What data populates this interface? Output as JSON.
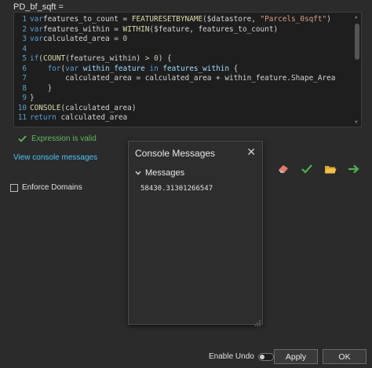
{
  "field": {
    "label": "PD_bf_sqft ="
  },
  "editor": {
    "lines": [
      {
        "num": "1",
        "tokens": [
          [
            "kw",
            "var"
          ],
          [
            "",
            "features_to_count = "
          ],
          [
            "fn",
            "FEATURESETBYNAME"
          ],
          [
            "",
            "($datastore, "
          ],
          [
            "str",
            "\"Parcels_0sqft\""
          ],
          [
            "",
            ")"
          ]
        ]
      },
      {
        "num": "2",
        "tokens": [
          [
            "kw",
            "var"
          ],
          [
            "",
            "features_within = "
          ],
          [
            "fn",
            "WITHIN"
          ],
          [
            "",
            "($feature, features_to_count)"
          ]
        ]
      },
      {
        "num": "3",
        "tokens": [
          [
            "kw",
            "var"
          ],
          [
            "",
            "calculated_area = "
          ],
          [
            "num",
            "0"
          ]
        ]
      },
      {
        "num": "4",
        "tokens": []
      },
      {
        "num": "5",
        "tokens": [
          [
            "kw",
            "if"
          ],
          [
            "",
            "("
          ],
          [
            "fn",
            "COUNT"
          ],
          [
            "",
            "(features_within) > "
          ],
          [
            "num",
            "0"
          ],
          [
            "",
            ") {"
          ]
        ]
      },
      {
        "num": "6",
        "tokens": [
          [
            "",
            "    "
          ],
          [
            "kw",
            "for"
          ],
          [
            "",
            "("
          ],
          [
            "kw",
            "var"
          ],
          [
            "var",
            " within_feature "
          ],
          [
            "kw",
            "in"
          ],
          [
            "",
            ""
          ],
          [
            "var",
            " features_within"
          ],
          [
            "",
            " {"
          ]
        ]
      },
      {
        "num": "7",
        "tokens": [
          [
            "",
            "        calculated_area = calculated_area + within_feature.Shape_Area"
          ]
        ]
      },
      {
        "num": "8",
        "tokens": [
          [
            "",
            "    }"
          ]
        ]
      },
      {
        "num": "9",
        "tokens": [
          [
            "",
            "}"
          ]
        ]
      },
      {
        "num": "10",
        "tokens": [
          [
            "fn",
            "CONSOLE"
          ],
          [
            "",
            "(calculated_area)"
          ]
        ]
      },
      {
        "num": "11",
        "tokens": [
          [
            "kw",
            "return"
          ],
          [
            "",
            " calculated_area"
          ]
        ]
      }
    ]
  },
  "status": {
    "valid_text": "Expression is valid",
    "color": "#5fb85f"
  },
  "console_link": "View console messages",
  "toolbar": {
    "icons": [
      "eraser-icon",
      "check-icon",
      "folder-open-icon",
      "arrow-right-icon"
    ]
  },
  "enforce_domains": {
    "label": "Enforce Domains",
    "checked": false
  },
  "console_panel": {
    "title": "Console Messages",
    "close_glyph": "✕",
    "section_title": "Messages",
    "messages": [
      "58430.31301266547"
    ]
  },
  "undo": {
    "label": "Enable Undo",
    "enabled": false
  },
  "buttons": {
    "apply": "Apply",
    "ok": "OK"
  },
  "colors": {
    "background": "#2b2b2b",
    "editor_bg": "#1e1e1e",
    "link": "#4fc3f7",
    "keyword": "#569cd6",
    "function": "#dcdcaa",
    "string": "#d69d85"
  }
}
